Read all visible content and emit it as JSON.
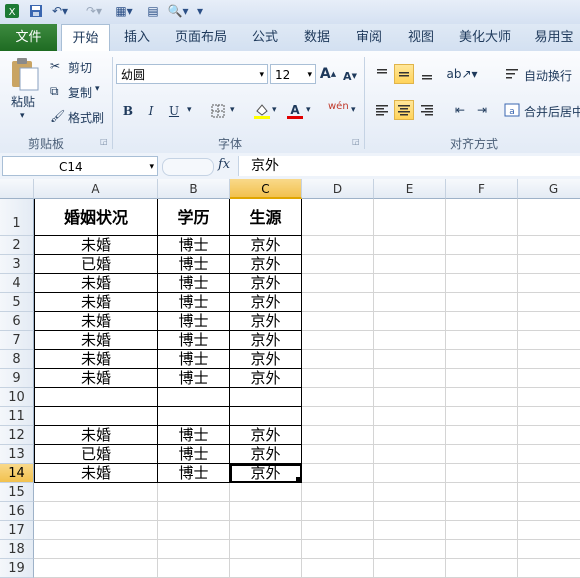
{
  "quick_access": {
    "save": "save-icon",
    "undo": "undo-icon",
    "redo": "redo-icon"
  },
  "tabs": [
    {
      "label": "文件"
    },
    {
      "label": "开始"
    },
    {
      "label": "插入"
    },
    {
      "label": "页面布局"
    },
    {
      "label": "公式"
    },
    {
      "label": "数据"
    },
    {
      "label": "审阅"
    },
    {
      "label": "视图"
    },
    {
      "label": "美化大师"
    },
    {
      "label": "易用宝"
    }
  ],
  "ribbon": {
    "clipboard": {
      "label": "剪贴板",
      "paste": "粘贴",
      "cut": "剪切",
      "copy": "复制",
      "format_painter": "格式刷"
    },
    "font": {
      "label": "字体",
      "font_name": "幼圆",
      "font_size": "12",
      "grow": "A",
      "shrink": "A",
      "bold": "B",
      "italic": "I",
      "underline": "U",
      "font_color_glyph": "A",
      "wen": "wén"
    },
    "alignment": {
      "label": "对齐方式",
      "wrap_text": "自动换行",
      "merge_center": "合并后居中"
    }
  },
  "formula_bar": {
    "name_box": "C14",
    "fx": "fx",
    "content": "京外"
  },
  "sheet": {
    "columns": [
      "A",
      "B",
      "C",
      "D",
      "E",
      "F",
      "G"
    ],
    "active_column": "C",
    "active_row": "14",
    "rows": [
      {
        "num": "1",
        "cells": [
          "婚姻状况",
          "学历",
          "生源"
        ]
      },
      {
        "num": "2",
        "cells": [
          "未婚",
          "博士",
          "京外"
        ]
      },
      {
        "num": "3",
        "cells": [
          "已婚",
          "博士",
          "京外"
        ]
      },
      {
        "num": "4",
        "cells": [
          "未婚",
          "博士",
          "京外"
        ]
      },
      {
        "num": "5",
        "cells": [
          "未婚",
          "博士",
          "京外"
        ]
      },
      {
        "num": "6",
        "cells": [
          "未婚",
          "博士",
          "京外"
        ]
      },
      {
        "num": "7",
        "cells": [
          "未婚",
          "博士",
          "京外"
        ]
      },
      {
        "num": "8",
        "cells": [
          "未婚",
          "博士",
          "京外"
        ]
      },
      {
        "num": "9",
        "cells": [
          "未婚",
          "博士",
          "京外"
        ]
      },
      {
        "num": "10",
        "cells": [
          "",
          "",
          ""
        ]
      },
      {
        "num": "11",
        "cells": [
          "",
          "",
          ""
        ]
      },
      {
        "num": "12",
        "cells": [
          "未婚",
          "博士",
          "京外"
        ]
      },
      {
        "num": "13",
        "cells": [
          "已婚",
          "博士",
          "京外"
        ]
      },
      {
        "num": "14",
        "cells": [
          "未婚",
          "博士",
          "京外"
        ]
      },
      {
        "num": "15",
        "cells": [
          "",
          "",
          ""
        ]
      },
      {
        "num": "16",
        "cells": [
          "",
          "",
          ""
        ]
      },
      {
        "num": "17",
        "cells": [
          "",
          "",
          ""
        ]
      },
      {
        "num": "18",
        "cells": [
          "",
          "",
          ""
        ]
      },
      {
        "num": "19",
        "cells": [
          "",
          "",
          ""
        ]
      }
    ]
  },
  "colors": {
    "file_tab": "#2a7b2e",
    "selection": "#f2c14e",
    "grid_line": "#d4d4d4"
  }
}
